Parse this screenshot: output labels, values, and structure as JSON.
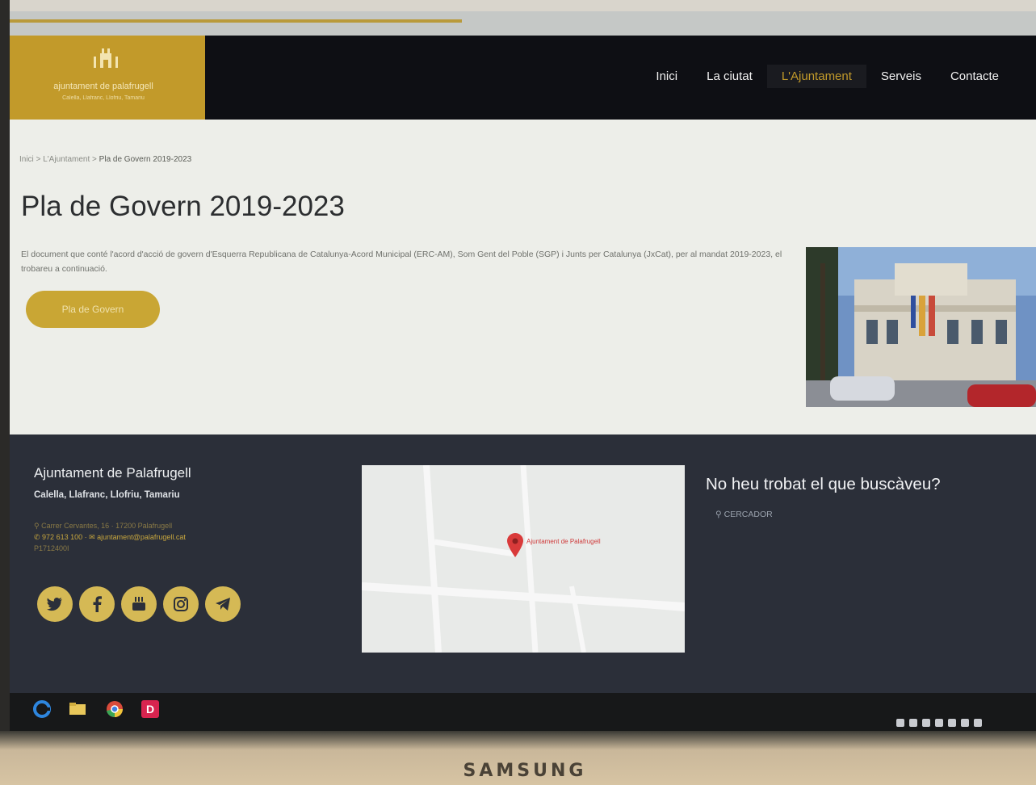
{
  "device": {
    "brand": "SAMSUNG"
  },
  "site": {
    "logo": {
      "name": "ajuntament de palafrugell",
      "subtitle": "Calella, Llafranc, Llofriu, Tamariu"
    },
    "nav": {
      "items": [
        {
          "label": "Inici",
          "active": false
        },
        {
          "label": "La ciutat",
          "active": false
        },
        {
          "label": "L'Ajuntament",
          "active": true
        },
        {
          "label": "Serveis",
          "active": false
        },
        {
          "label": "Contacte",
          "active": false
        }
      ]
    },
    "breadcrumb": {
      "items": [
        "Inici",
        "L'Ajuntament"
      ],
      "separator": ">",
      "current": "Pla de Govern 2019-2023"
    },
    "page": {
      "title": "Pla de Govern 2019-2023",
      "intro": "El document que conté l'acord d'acció de govern d'Esquerra Republicana de Catalunya-Acord Municipal (ERC-AM), Som Gent del Poble (SGP) i Junts per Catalunya (JxCat), per al mandat 2019-2023, el trobareu a continuació.",
      "button": "Pla de Govern"
    },
    "footer": {
      "org": "Ajuntament de Palafrugell",
      "towns": "Calella, Llafranc, Llofriu, Tamariu",
      "address": "Carrer Cervantes, 16 · 17200 Palafrugell",
      "phone": "972 613 100",
      "email": "ajuntament@palafrugell.cat",
      "nif": "P1712400I",
      "map_label": "Ajuntament de Palafrugell",
      "search_title": "No heu trobat el que buscàveu?",
      "search_link": "CERCADOR",
      "social": [
        "twitter-icon",
        "facebook-icon",
        "youtube-icon",
        "instagram-icon",
        "telegram-icon"
      ]
    }
  },
  "taskbar": {
    "icons": [
      "edge-icon",
      "file-explorer-icon",
      "chrome-icon",
      "app-d-icon"
    ]
  },
  "colors": {
    "gold": "#c29a2a",
    "header": "#0e0f14",
    "footer": "#2b2f39"
  }
}
